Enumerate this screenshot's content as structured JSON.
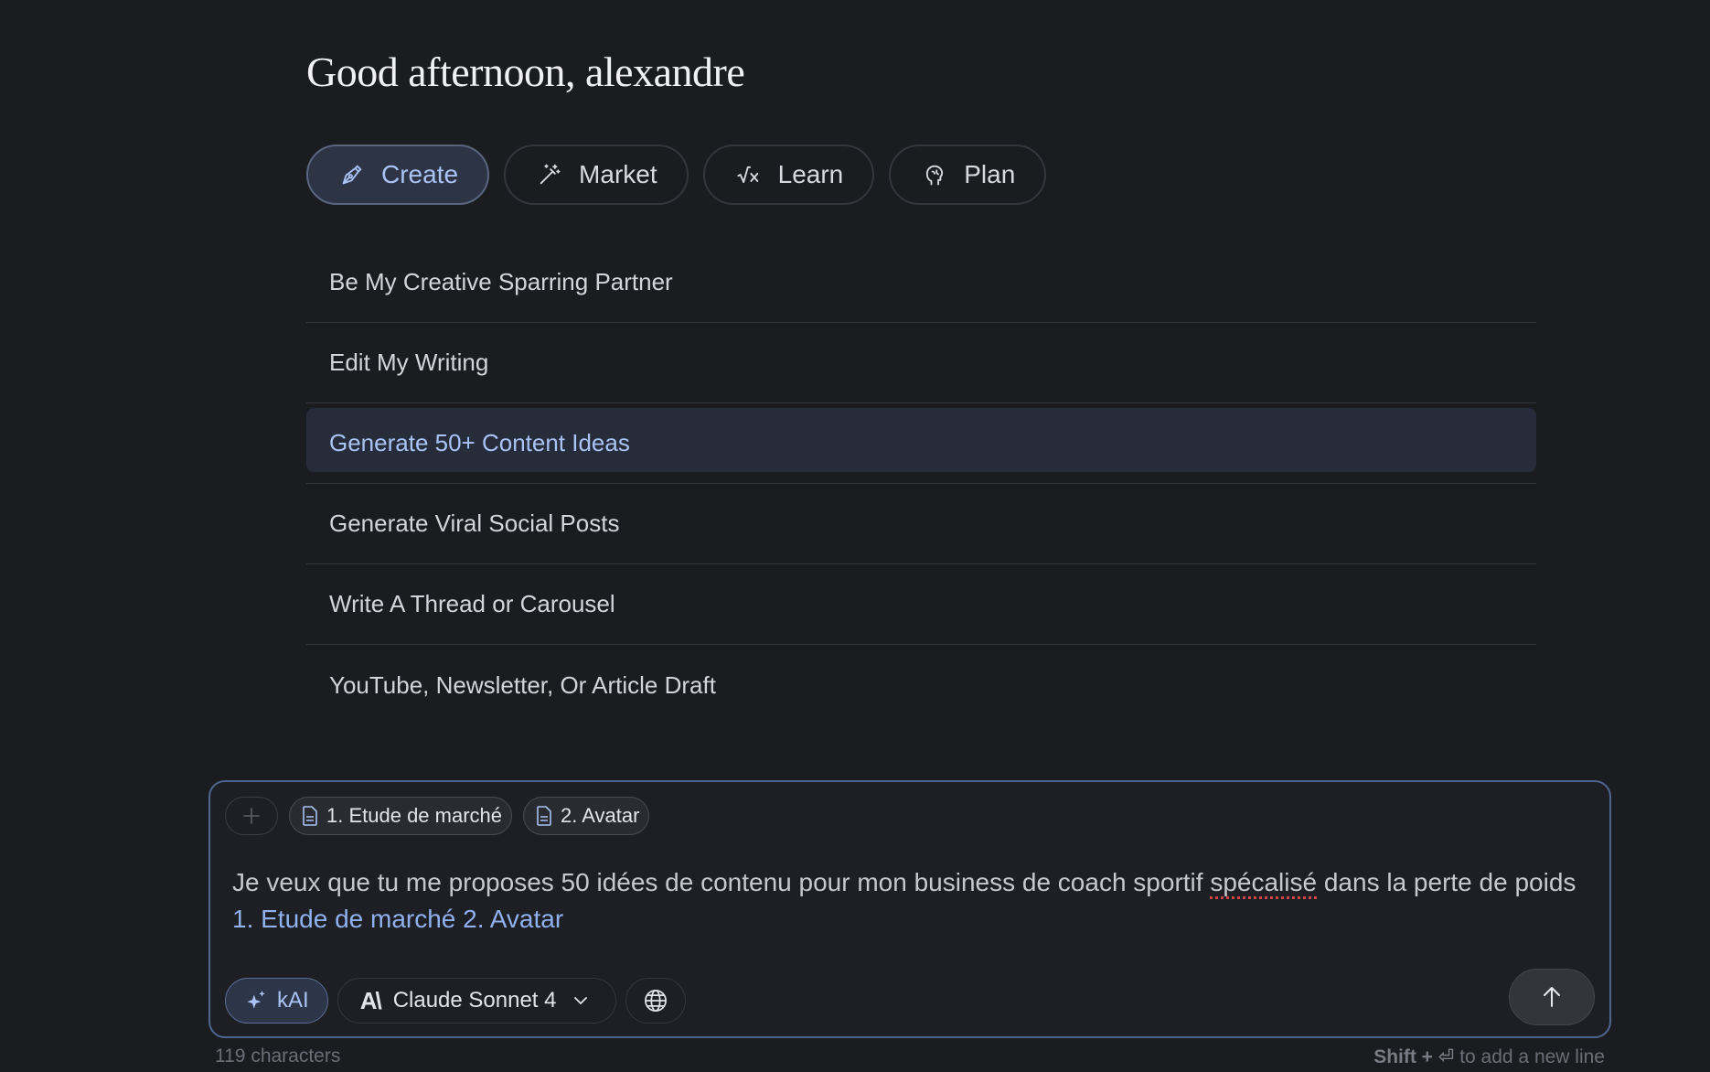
{
  "greeting": "Good afternoon, alexandre",
  "tabs": [
    {
      "label": "Create",
      "icon": "pen-nib-icon",
      "active": true
    },
    {
      "label": "Market",
      "icon": "magic-wand-icon",
      "active": false
    },
    {
      "label": "Learn",
      "icon": "square-root-icon",
      "active": false
    },
    {
      "label": "Plan",
      "icon": "brain-icon",
      "active": false
    }
  ],
  "prompts": [
    "Be My Creative Sparring Partner",
    "Edit My Writing",
    "Generate 50+ Content Ideas",
    "Generate Viral Social Posts",
    "Write A Thread or Carousel",
    "YouTube, Newsletter, Or Article Draft"
  ],
  "composer": {
    "attachments": [
      "1. Etude de marché",
      "2. Avatar"
    ],
    "message": {
      "part1": "Je veux que tu me proposes 50 idées de contenu pour mon business de coach sportif ",
      "typo_word": "spécalisé",
      "part2": " dans la perte de poids ",
      "ref1": "1. Etude de marché",
      "ref2": "2. Avatar"
    },
    "kai_label": "kAI",
    "model_label": "Claude Sonnet 4",
    "model_logo": "A\\",
    "globe_icon": "globe-icon",
    "send_icon": "arrow-up-icon"
  },
  "footer": {
    "char_count": "119 characters",
    "hint_key": "Shift + ⏎",
    "hint_text": " to add a new line"
  },
  "colors": {
    "background": "#1b1c20",
    "accent": "#a9c3f5",
    "active_tab_bg": "#2d3446",
    "composer_border": "#4f6590"
  }
}
